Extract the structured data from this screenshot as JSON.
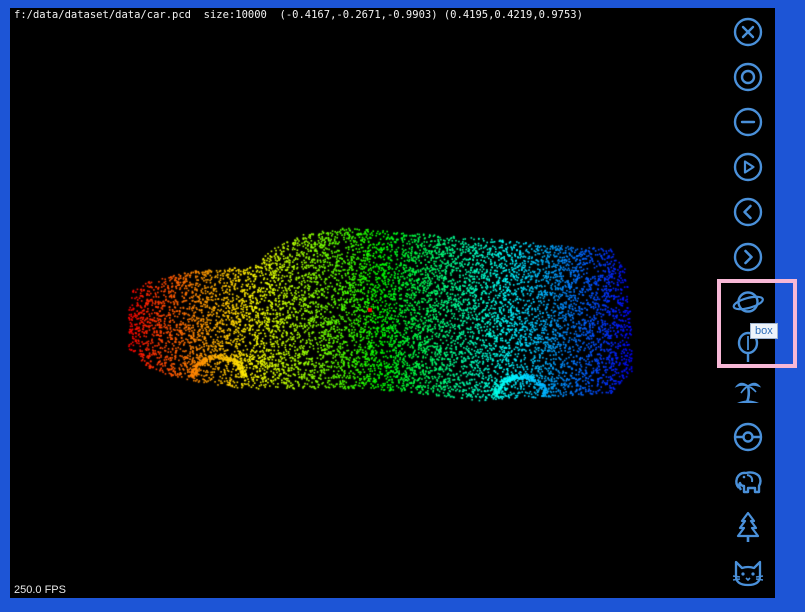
{
  "viewer": {
    "info": "f:/data/dataset/data/car.pcd  size:10000  (-0.4167,-0.2671,-0.9903) (0.4195,0.4219,0.9753)",
    "fps": "250.0 FPS",
    "point_count": 10000
  },
  "toolbar": [
    {
      "icon": "close-icon",
      "name": "close"
    },
    {
      "icon": "record-icon",
      "name": "record"
    },
    {
      "icon": "minus-icon",
      "name": "minus"
    },
    {
      "icon": "play-icon",
      "name": "play"
    },
    {
      "icon": "previous-icon",
      "name": "previous"
    },
    {
      "icon": "next-icon",
      "name": "next"
    },
    {
      "icon": "planet-icon",
      "name": "planet",
      "highlighted": true
    },
    {
      "icon": "balloon-icon",
      "name": "balloon"
    },
    {
      "icon": "palm-island-icon",
      "name": "island"
    },
    {
      "icon": "pokeball-icon",
      "name": "pokeball"
    },
    {
      "icon": "elephant-icon",
      "name": "elephant"
    },
    {
      "icon": "pine-tree-icon",
      "name": "tree"
    },
    {
      "icon": "cat-icon",
      "name": "cat"
    }
  ],
  "tooltip": {
    "text": "box"
  },
  "colors": {
    "frame": "#1d55d6",
    "icon": "#4a90d9",
    "highlight": "#f7b8d6",
    "background": "#000000"
  }
}
